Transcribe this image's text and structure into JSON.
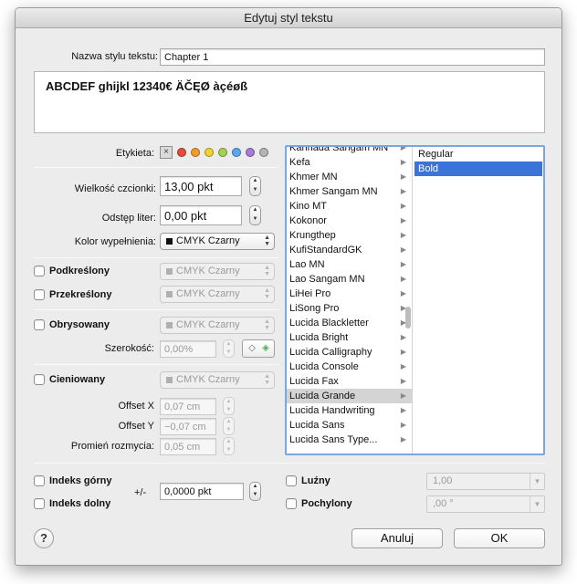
{
  "window": {
    "title": "Edytuj styl tekstu"
  },
  "style_name": {
    "label": "Nazwa stylu tekstu:",
    "value": "Chapter 1"
  },
  "preview": {
    "text": "ABCDEF ghijkl 12340€ ÄČĘØ àçéøß"
  },
  "tags": {
    "label": "Etykieta:",
    "clear_glyph": "×",
    "colors": [
      "#e84b3c",
      "#f39c2a",
      "#f2d32b",
      "#a7d34b",
      "#5ba8ee",
      "#a77bd8",
      "#b4b4b4"
    ]
  },
  "font_size": {
    "label": "Wielkość czcionki:",
    "value": "13,00 pkt"
  },
  "tracking": {
    "label": "Odstęp liter:",
    "value": "0,00 pkt"
  },
  "fill_color": {
    "label": "Kolor wypełnienia:",
    "value": "CMYK Czarny"
  },
  "underline": {
    "label": "Podkreślony",
    "color": "CMYK Czarny"
  },
  "strikethrough": {
    "label": "Przekreślony",
    "color": "CMYK Czarny"
  },
  "outline": {
    "label": "Obrysowany",
    "color": "CMYK Czarny",
    "width_label": "Szerokość:",
    "width_value": "0,00%"
  },
  "shadow": {
    "label": "Cieniowany",
    "color": "CMYK Czarny",
    "offset_x_label": "Offset X",
    "offset_x_value": "0,07 cm",
    "offset_y_label": "Offset Y",
    "offset_y_value": "−0,07 cm",
    "blur_label": "Promień rozmycia:",
    "blur_value": "0,05 cm"
  },
  "fonts": {
    "families": [
      "Kannada Sangam MN",
      "Kefa",
      "Khmer MN",
      "Khmer Sangam MN",
      "Kino MT",
      "Kokonor",
      "Krungthep",
      "KufiStandardGK",
      "Lao MN",
      "Lao Sangam MN",
      "LiHei Pro",
      "LiSong Pro",
      "Lucida Blackletter",
      "Lucida Bright",
      "Lucida Calligraphy",
      "Lucida Console",
      "Lucida Fax",
      "Lucida Grande",
      "Lucida Handwriting",
      "Lucida Sans",
      "Lucida Sans Type..."
    ],
    "selected_family": "Lucida Grande",
    "styles": [
      "Regular",
      "Bold"
    ],
    "selected_style": "Bold",
    "chevron": "▶"
  },
  "superscript": {
    "label": "Indeks górny"
  },
  "subscript": {
    "label": "Indeks dolny"
  },
  "baseline": {
    "label": "+/-",
    "value": "0,0000 pkt"
  },
  "loose": {
    "label": "Luźny",
    "value": "1,00"
  },
  "italic": {
    "label": "Pochylony",
    "value": ",00 °"
  },
  "buttons": {
    "help": "?",
    "cancel": "Anuluj",
    "ok": "OK"
  }
}
